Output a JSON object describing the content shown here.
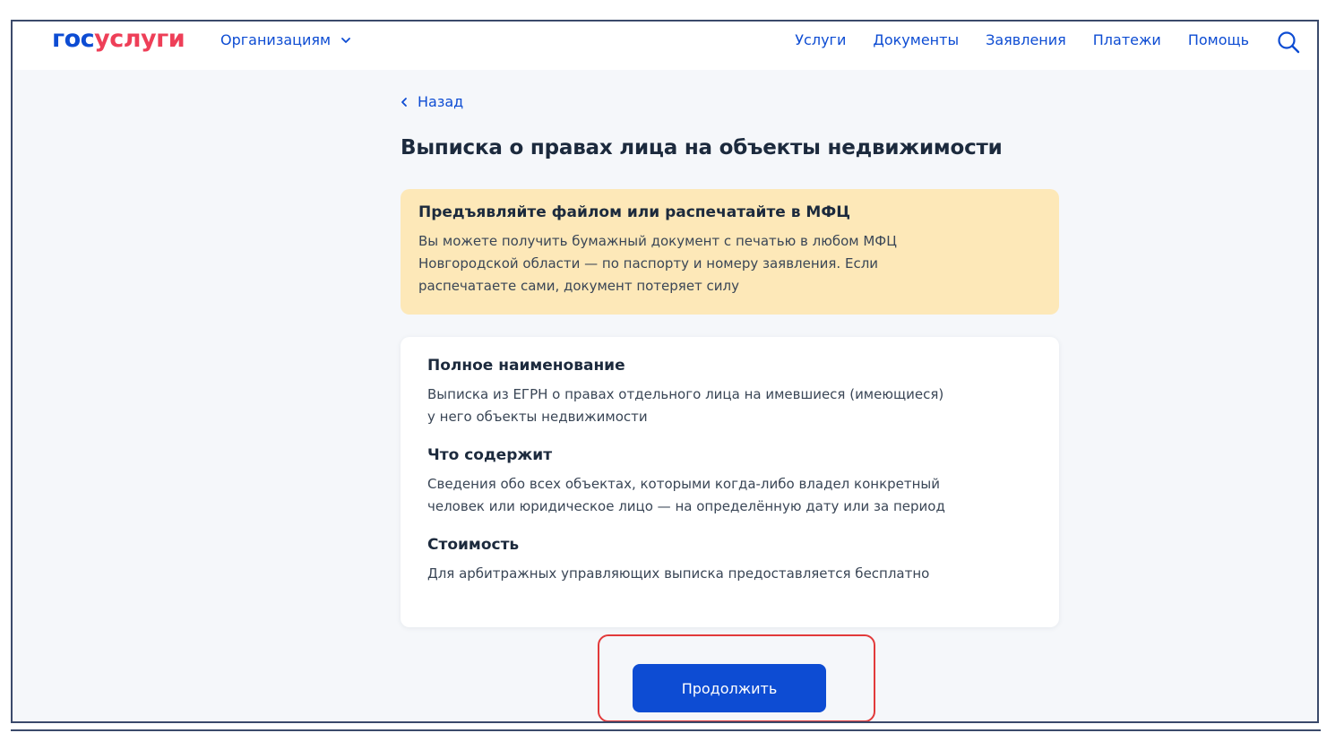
{
  "header": {
    "logo_part1": "гос",
    "logo_part2": "услуги",
    "org_menu_label": "Организациям",
    "nav": [
      "Услуги",
      "Документы",
      "Заявления",
      "Платежи",
      "Помощь"
    ]
  },
  "back_label": "Назад",
  "page_title": "Выписка о правах лица на объекты недвижимости",
  "notice": {
    "title": "Предъявляйте файлом или распечатайте в МФЦ",
    "lines": [
      "Вы можете получить бумажный документ с печатью в любом МФЦ",
      "Новгородской области — по паспорту и номеру заявления. Если",
      "распечатаете сами, документ потеряет силу"
    ]
  },
  "card": {
    "sections": [
      {
        "title": "Полное наименование",
        "lines": [
          "Выписка из ЕГРН о правах отдельного лица на имевшиеся (имеющиеся)",
          "у него объекты недвижимости"
        ]
      },
      {
        "title": "Что содержит",
        "lines": [
          "Сведения обо всех объектах, которыми когда-либо владел конкретный",
          "человек или юридическое лицо — на определённую дату или за период"
        ]
      },
      {
        "title": "Стоимость",
        "lines": [
          "Для арбитражных управляющих выписка предоставляется бесплатно"
        ]
      }
    ]
  },
  "continue_label": "Продолжить",
  "colors": {
    "brand_blue": "#0d4cd3",
    "brand_red": "#ee3f58",
    "notice_bg": "#fde8b8",
    "highlight_red": "#e23a3a"
  }
}
